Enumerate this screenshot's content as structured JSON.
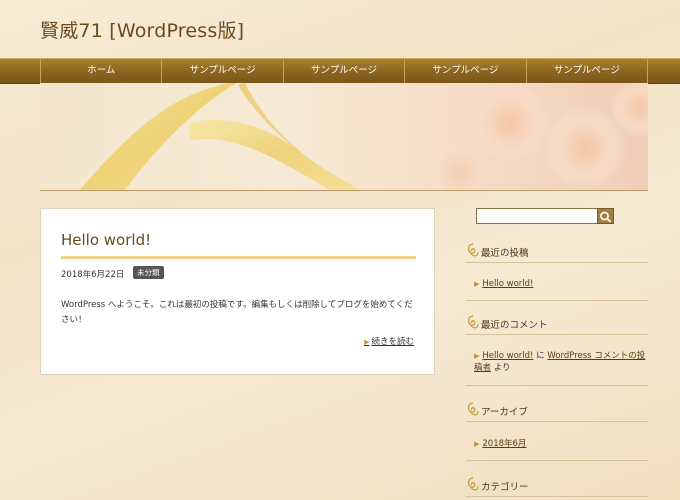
{
  "site": {
    "title": "賢威71 [WordPress版]"
  },
  "nav": {
    "items": [
      "ホーム",
      "サンプルページ",
      "サンプルページ",
      "サンプルページ",
      "サンプルページ"
    ]
  },
  "post": {
    "title": "Hello world!",
    "date": "2018年6月22日",
    "category": "未分類",
    "body": "WordPress へようこそ。これは最初の投稿です。編集もしくは削除してブログを始めてください！",
    "read_more": "続きを読む"
  },
  "sidebar": {
    "search": {
      "value": "",
      "placeholder": ""
    },
    "recent_posts": {
      "title": "最近の投稿",
      "items": [
        "Hello world!"
      ]
    },
    "recent_comments": {
      "title": "最近のコメント",
      "author": "Hello world!",
      "connector": "に",
      "commenter": "WordPress コメントの投稿者",
      "suffix": "より"
    },
    "archives": {
      "title": "アーカイブ",
      "items": [
        "2018年6月"
      ]
    },
    "categories": {
      "title": "カテゴリー"
    }
  },
  "colors": {
    "nav_bg": "#8c6620",
    "accent": "#f2d28a",
    "title": "#6b4a1c"
  }
}
